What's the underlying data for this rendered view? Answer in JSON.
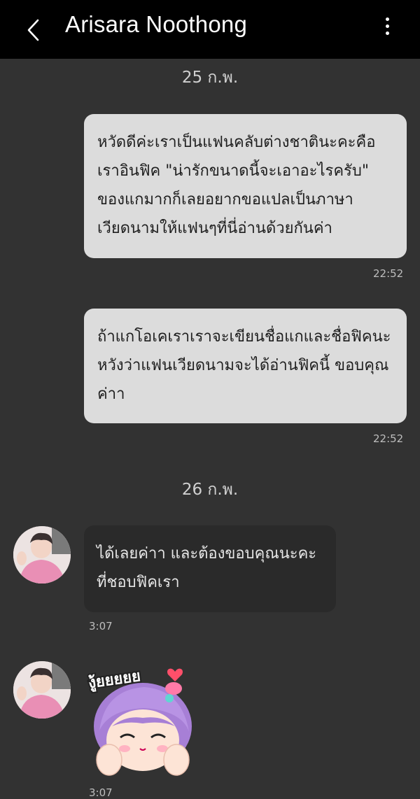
{
  "header": {
    "contact_name": "Arisara Noothong",
    "back_icon": "chevron-left-icon",
    "menu_icon": "more-vertical-icon"
  },
  "conversation": {
    "date_1": "25 ก.พ.",
    "date_2": "26 ก.พ.",
    "outgoing": [
      {
        "text": "หวัดดีค่ะเราเป็นแฟนคลับต่างชาตินะคะคือเราอินฟิค \"น่ารักขนาดนี้จะเอาอะไรครับ\" ของแกมากก็เลยอยากขอแปลเป็นภาษาเวียดนามให้แฟนๆที่นี่อ่านด้วยกันค่า",
        "time": "22:52"
      },
      {
        "text": "ถ้าแกโอเคเราเราจะเขียนชื่อแกและชื่อฟิคนะ หวังว่าแฟนเวียดนามจะได้อ่านฟิคนี้ ขอบคุณค่าา",
        "time": "22:52"
      }
    ],
    "incoming": [
      {
        "text": "ได้เลยค่าา และต้องขอบคุณนะคะที่ชอบฟิคเรา",
        "time": "3:07"
      },
      {
        "sticker_label": "งู้ยยยยย",
        "sticker_icon": "purple-hair-girl-sticker",
        "time": "3:07"
      }
    ]
  },
  "colors": {
    "background": "#323232",
    "header": "#000000",
    "outgoing_bubble": "#dcdcdc",
    "incoming_bubble": "#2a2a2a"
  }
}
